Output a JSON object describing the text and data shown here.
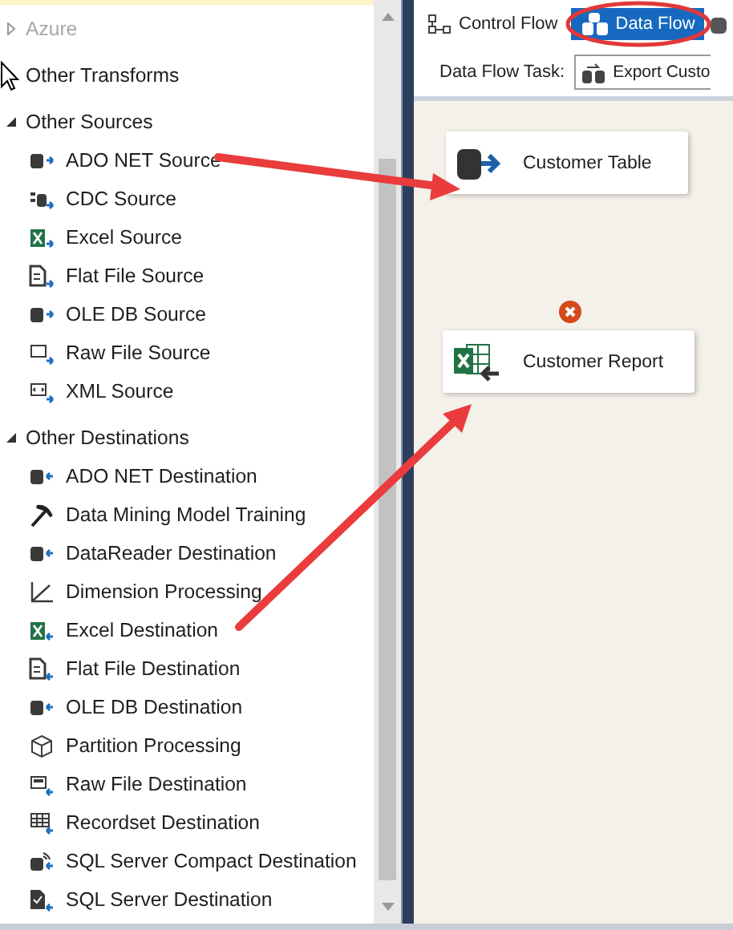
{
  "toolbox": {
    "groups": [
      {
        "label": "Azure",
        "expanded": false,
        "disabled": true
      },
      {
        "label": "Other Transforms",
        "expanded": false,
        "disabled": false
      },
      {
        "label": "Other Sources",
        "expanded": true,
        "disabled": false,
        "children": [
          {
            "label": "ADO NET Source",
            "kind": "db-source"
          },
          {
            "label": "CDC Source",
            "kind": "cdc"
          },
          {
            "label": "Excel Source",
            "kind": "excel-source"
          },
          {
            "label": "Flat File Source",
            "kind": "file-source"
          },
          {
            "label": "OLE DB Source",
            "kind": "db-source"
          },
          {
            "label": "Raw File Source",
            "kind": "raw-source"
          },
          {
            "label": "XML Source",
            "kind": "xml-source"
          }
        ]
      },
      {
        "label": "Other Destinations",
        "expanded": true,
        "disabled": false,
        "children": [
          {
            "label": "ADO NET Destination",
            "kind": "db-dest"
          },
          {
            "label": "Data Mining Model Training",
            "kind": "pick"
          },
          {
            "label": "DataReader Destination",
            "kind": "db-dest"
          },
          {
            "label": "Dimension Processing",
            "kind": "axes"
          },
          {
            "label": "Excel Destination",
            "kind": "excel-dest"
          },
          {
            "label": "Flat File Destination",
            "kind": "file-dest"
          },
          {
            "label": "OLE DB Destination",
            "kind": "db-dest"
          },
          {
            "label": "Partition Processing",
            "kind": "cube"
          },
          {
            "label": "Raw File Destination",
            "kind": "raw-dest"
          },
          {
            "label": "Recordset Destination",
            "kind": "grid-dest"
          },
          {
            "label": "SQL Server Compact Destination",
            "kind": "compact-dest"
          },
          {
            "label": "SQL Server Destination",
            "kind": "sql-dest"
          }
        ]
      }
    ]
  },
  "designer": {
    "tabs": [
      {
        "label": "Control Flow",
        "selected": false
      },
      {
        "label": "Data Flow",
        "selected": true
      }
    ],
    "task_label": "Data Flow Task:",
    "task_value": "Export Custo",
    "nodes": [
      {
        "label": "Customer Table",
        "kind": "source",
        "error": false
      },
      {
        "label": "Customer Report",
        "kind": "excel-dest",
        "error": true
      }
    ]
  }
}
